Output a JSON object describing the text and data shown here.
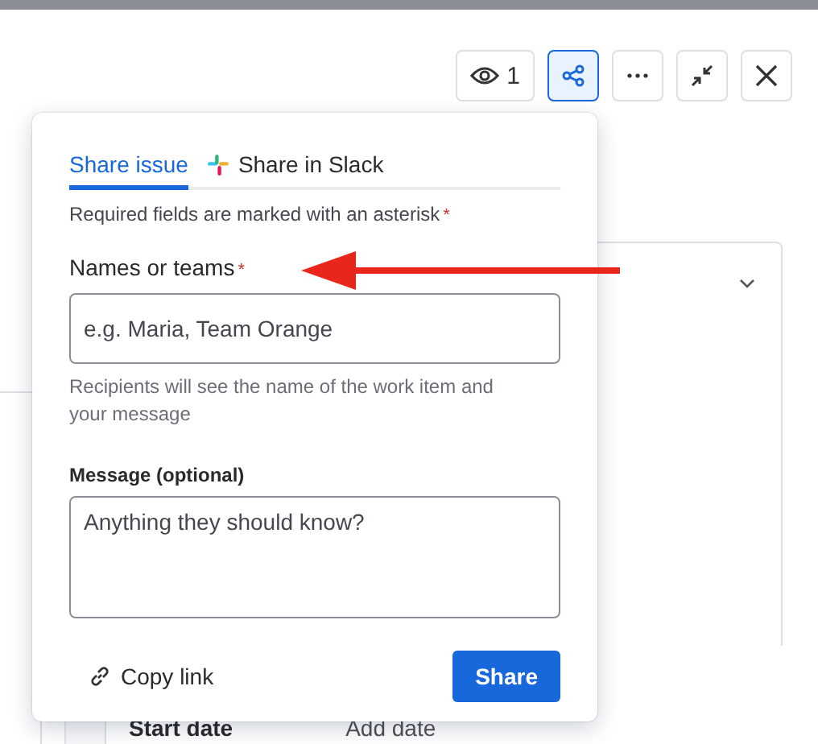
{
  "toolbar": [
    {
      "kind": "watch",
      "label": "1",
      "selected": false
    },
    {
      "kind": "share",
      "selected": true
    },
    {
      "kind": "more",
      "selected": false
    },
    {
      "kind": "collapse",
      "selected": false
    },
    {
      "kind": "close",
      "selected": false
    }
  ],
  "background_row": {
    "label": "Start date",
    "value": "Add date"
  },
  "share_popover": {
    "tabs": [
      {
        "kind": "plain",
        "label": "Share issue",
        "selected": true
      },
      {
        "kind": "slack",
        "label": "Share in Slack",
        "selected": false
      }
    ],
    "required_note": {
      "text": "Required fields are marked with an asterisk",
      "mark": "*"
    },
    "names_field": {
      "label": "Names or teams",
      "mark": "*",
      "placeholder": "e.g. Maria, Team Orange",
      "help": "Recipients will see the name of the work item and your message"
    },
    "message_field": {
      "label": "Message (optional)",
      "placeholder": "Anything they should know?"
    },
    "copy_link": "Copy link",
    "share_button": "Share"
  }
}
